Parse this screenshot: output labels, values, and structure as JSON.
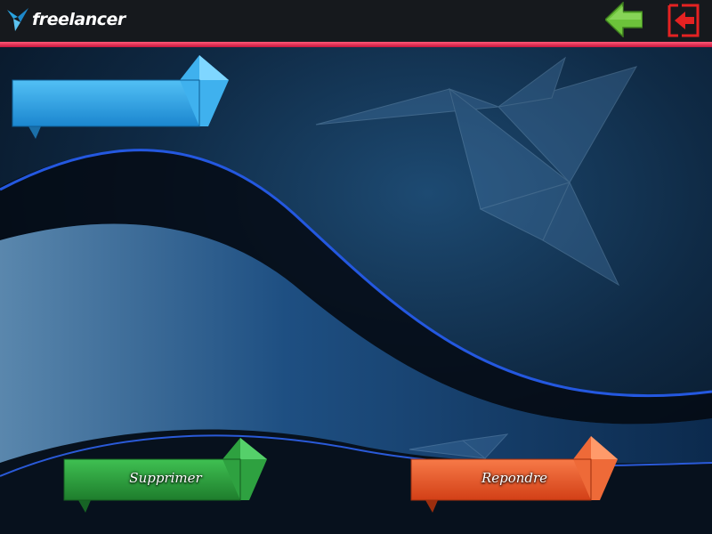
{
  "header": {
    "logo_text": "freelancer",
    "logo_icon": "bird-icon",
    "back_icon": "arrow-left-icon",
    "exit_icon": "logout-icon"
  },
  "main": {
    "title_banner_text": "",
    "delete_label": "Supprimer",
    "reply_label": "Repondre"
  },
  "colors": {
    "header_bg": "#16191d",
    "accent_line": "#e8284c",
    "back_green": "#6cc23a",
    "exit_red": "#e52222",
    "banner_blue": "#2ea4e6",
    "delete_green": "#2f9e3c",
    "reply_orange": "#e8542a"
  }
}
